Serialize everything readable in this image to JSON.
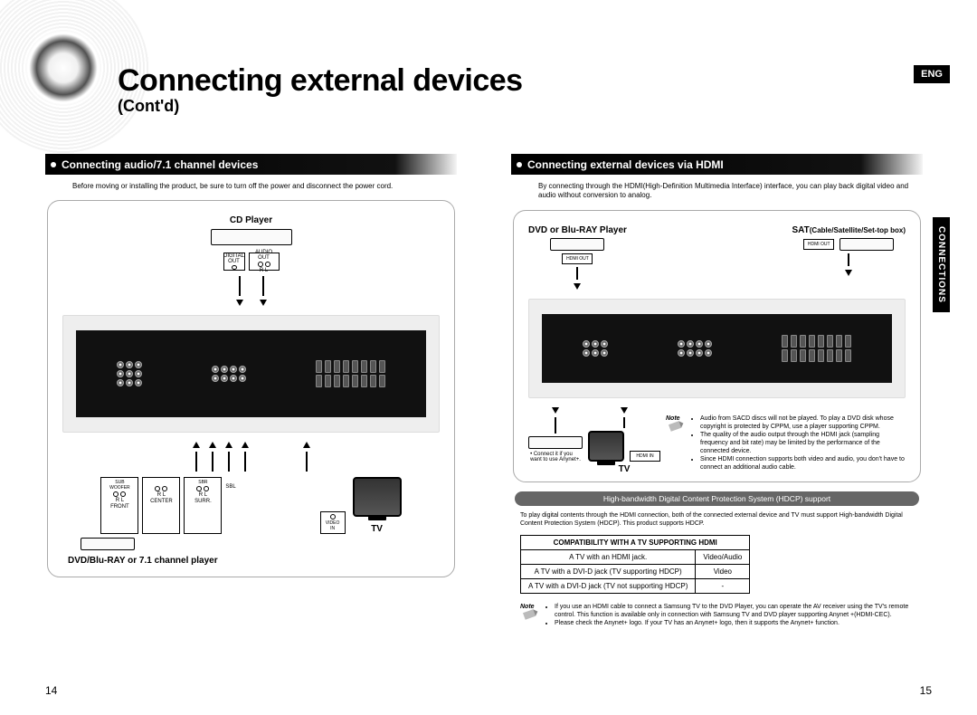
{
  "lang_badge": "ENG",
  "side_tab": "CONNECTIONS",
  "title": "Connecting external devices",
  "title_sub": "(Cont'd)",
  "left": {
    "section": "Connecting audio/7.1 channel devices",
    "caution": "Before moving or installing the product, be sure to turn off the power and disconnect the power cord.",
    "cd_player": "CD Player",
    "digital_out": "DIGITAL\nOUT",
    "audio_out": "AUDIO\nOUT",
    "rl": "R   L",
    "front": "FRONT",
    "center": "CENTER",
    "surr": "SURR.",
    "sbl": "SBL",
    "sub_woofer": "SUB\nWOOFER",
    "sbr": "SBR",
    "video_in": "VIDEO\nIN",
    "tv": "TV",
    "bottom_label": "DVD/Blu-RAY or 7.1 channel player",
    "page_num": "14"
  },
  "right": {
    "section": "Connecting external devices via HDMI",
    "caution": "By connecting through the HDMI(High-Definition Multimedia Interface) interface, you can play back digital video and audio without conversion to analog.",
    "dvd_label": "DVD or Blu-RAY Player",
    "sat_label": "SAT",
    "sat_sub": "(Cable/Satellite/Set-top box)",
    "hdmi_out": "HDMI OUT",
    "hdmi_in": "HDMI  IN",
    "anynet_note": "• Connect it if you\nwant to use Anynet+.",
    "tv": "TV",
    "note_label": "Note",
    "notes": [
      "Audio from SACD discs will not be played. To play a DVD disk whose copyright is protected by CPPM, use a player supporting CPPM.",
      "The quality of the audio output through the HDMI jack (sampling frequency and bit rate) may be limited by the performance of the connected device.",
      "Since HDMI connection supports both video and audio, you don't have to connect an additional audio cable."
    ],
    "hdcp_pill": "High-bandwidth Digital Content Protection System (HDCP) support",
    "hdcp_desc": "To play digital contents through the HDMI connection, both of the connected external device and TV must support High-bandwidth Digital Content Protection System (HDCP). This product supports HDCP.",
    "compat_header": "COMPATIBILITY WITH A TV SUPPORTING HDMI",
    "compat_rows": [
      {
        "a": "A TV with an HDMI jack.",
        "b": "Video/Audio"
      },
      {
        "a": "A TV with a DVI-D jack (TV supporting HDCP)",
        "b": "Video"
      },
      {
        "a": "A TV with a DVI-D jack (TV not supporting HDCP)",
        "b": "-"
      }
    ],
    "note2_label": "Note",
    "note2": [
      "If you use an HDMI cable to connect a Samsung TV to the DVD Player, you can operate the AV receiver using the TV's remote control. This function is available only in connection with Samsung TV and DVD player supporting Anynet +(HDMI-CEC).",
      "Please check the Anynet+ logo. If your TV has an Anynet+ logo, then it supports the Anynet+ function."
    ],
    "page_num": "15"
  }
}
